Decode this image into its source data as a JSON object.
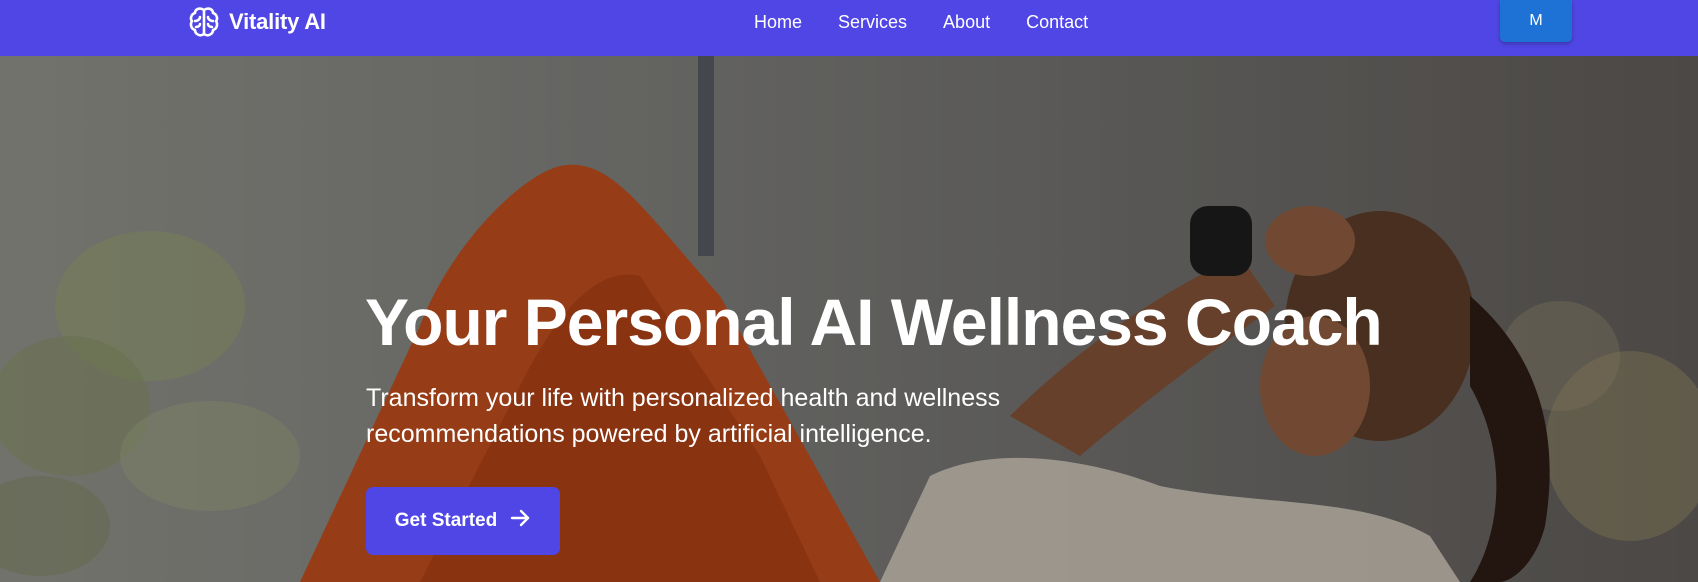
{
  "nav": {
    "brand": "Vitality AI",
    "brand_icon": "brain-icon",
    "links": [
      "Home",
      "Services",
      "About",
      "Contact"
    ],
    "user_button": "M"
  },
  "hero": {
    "title": "Your Personal AI Wellness Coach",
    "subtitle": "Transform your life with personalized health and wellness recommendations powered by artificial intelligence.",
    "cta_label": "Get Started",
    "cta_icon": "arrow-right-icon"
  },
  "colors": {
    "nav_bg": "#5046e5",
    "user_button_bg": "#1e72d6",
    "cta_bg": "#4f46e5"
  }
}
